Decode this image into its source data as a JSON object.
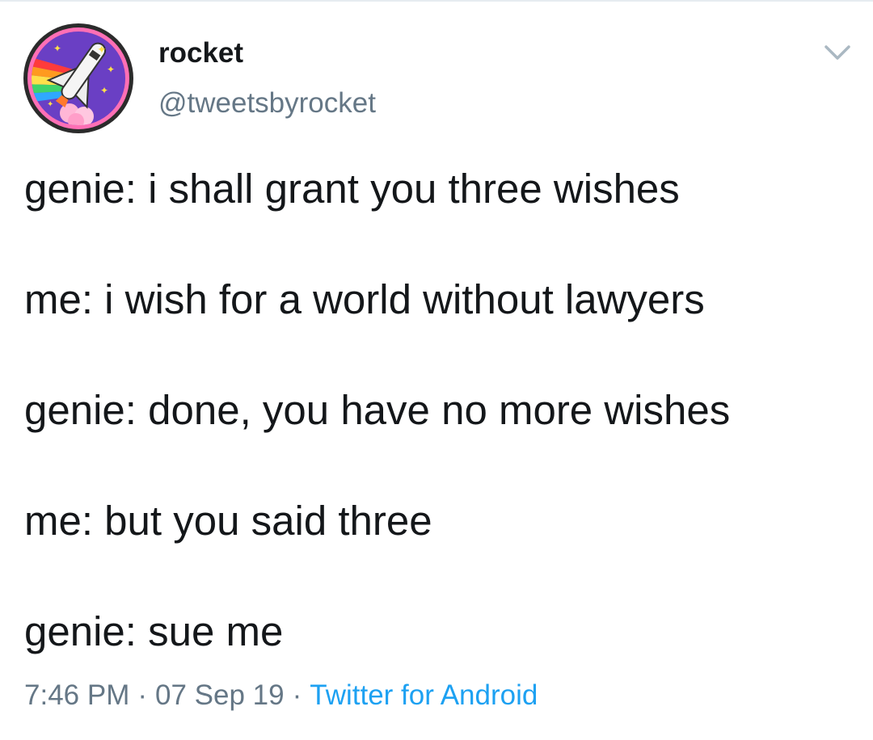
{
  "tweet": {
    "author": {
      "display_name": "rocket",
      "handle": "@tweetsbyrocket",
      "avatar_icon": "rocket-rainbow-avatar"
    },
    "menu_icon": "chevron-down-icon",
    "lines": [
      "genie: i shall grant you three wishes",
      "me: i wish for a world without lawyers",
      "genie: done, you have no more wishes",
      "me: but you said three",
      "genie: sue me"
    ],
    "time": "7:46 PM",
    "date": "07 Sep 19",
    "separator": "·",
    "source": "Twitter for Android"
  },
  "colors": {
    "text": "#14171a",
    "secondary_text": "#657786",
    "link": "#1da1f2",
    "divider": "#e6ecf0"
  }
}
